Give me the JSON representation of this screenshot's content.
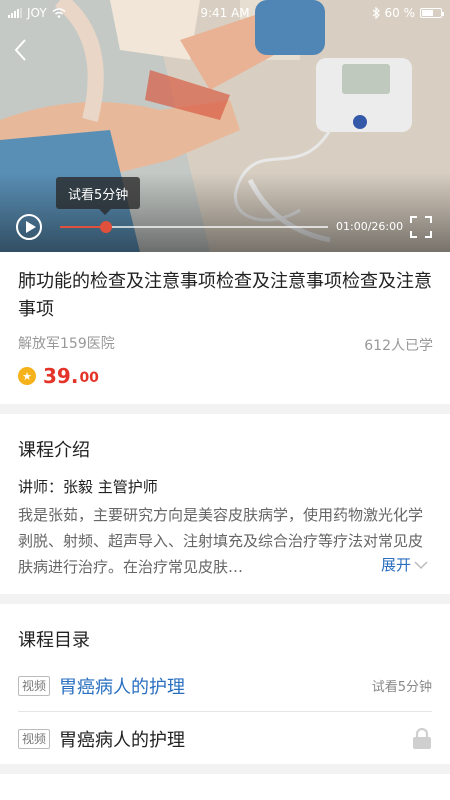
{
  "status_bar": {
    "carrier": "JOY",
    "time": "9:41 AM",
    "battery": "60 %",
    "battery_level": 0.6
  },
  "video": {
    "trial_tip": "试看5分钟",
    "time": "01:00/26:00",
    "progress": 0.17
  },
  "course": {
    "title": "肺功能的检查及注意事项检查及注意事项检查及注意事项",
    "hospital": "解放军159医院",
    "learners": "612人已学",
    "price_main": "39.",
    "price_decimal": "00"
  },
  "intro": {
    "title": "课程介绍",
    "lecturer": "讲师：张毅   主管护师",
    "text": "我是张茹，主要研究方向是美容皮肤病学，使用药物激光化学剥脱、射频、超声导入、注射填充及综合治疗等疗法对常见皮肤病进行治疗。在治疗常见皮肤…",
    "expand_label": "展开"
  },
  "catalog": {
    "title": "课程目录",
    "lessons": [
      {
        "tag": "视频",
        "title": "胃癌病人的护理",
        "meta": "试看5分钟"
      },
      {
        "tag": "视频",
        "title": "胃癌病人的护理"
      }
    ]
  },
  "colors": {
    "accent": "#2a6fc0",
    "price": "#e4342a",
    "progress": "#e0503a",
    "coin": "#f5b21b"
  }
}
